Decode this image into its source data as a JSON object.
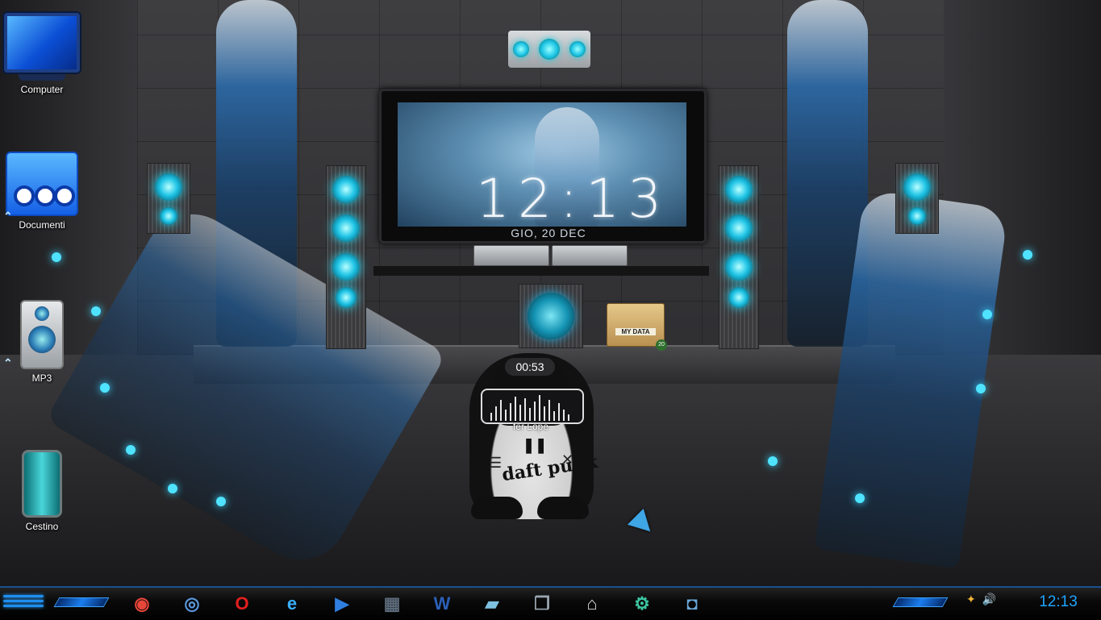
{
  "desktop": {
    "icons": [
      {
        "label": "Computer",
        "icon": "computer-monitor-icon"
      },
      {
        "label": "Documenti",
        "icon": "documents-folder-icon"
      },
      {
        "label": "MP3",
        "icon": "speaker-icon"
      },
      {
        "label": "Cestino",
        "icon": "recycle-bin-icon"
      }
    ]
  },
  "wallpaper_clock": {
    "time": "12:13",
    "date": "GIO, 20 DEC"
  },
  "music_player": {
    "elapsed": "00:53",
    "track": "fer Lope",
    "pause_glyph": "❚❚",
    "menu_glyph": "☰",
    "close_glyph": "✕",
    "logo": "daft punk"
  },
  "my_data_widget": {
    "label": "MY DATA",
    "badge": "20"
  },
  "taskbar": {
    "apps": [
      {
        "name": "chrome-icon",
        "glyph": "◉",
        "color": "#e8463a"
      },
      {
        "name": "chromium-icon",
        "glyph": "◎",
        "color": "#5b9ae0"
      },
      {
        "name": "opera-icon",
        "glyph": "O",
        "color": "#e31e1e"
      },
      {
        "name": "internet-explorer-icon",
        "glyph": "e",
        "color": "#3ab0ff"
      },
      {
        "name": "media-player-icon",
        "glyph": "▶",
        "color": "#2f7fe0"
      },
      {
        "name": "cube-app-icon",
        "glyph": "▦",
        "color": "#5c6a7a"
      },
      {
        "name": "word-icon",
        "glyph": "W",
        "color": "#2b5fb8"
      },
      {
        "name": "notepad-icon",
        "glyph": "▰",
        "color": "#7ec0e0"
      },
      {
        "name": "window-switcher-icon",
        "glyph": "❐",
        "color": "#9aa6b0"
      },
      {
        "name": "drive-icon",
        "glyph": "⌂",
        "color": "#d8dde2"
      },
      {
        "name": "settings-gear-icon",
        "glyph": "⚙",
        "color": "#3cc4a0"
      },
      {
        "name": "camera-icon",
        "glyph": "◘",
        "color": "#6aa8d8"
      }
    ],
    "tray": {
      "network": "✦",
      "volume": "🔊"
    },
    "clock": "12:13"
  },
  "colors": {
    "accent": "#1ea4ff",
    "neon": "#39d6ff"
  }
}
